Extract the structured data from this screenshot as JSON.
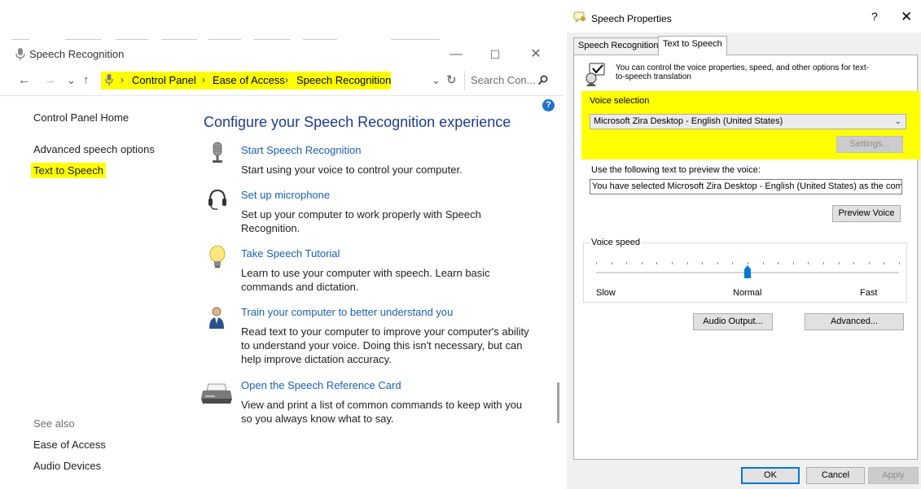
{
  "control_panel": {
    "window_title": "Speech Recognition",
    "window_controls": {
      "minimize": "—",
      "maximize": "☐",
      "close": "✕"
    },
    "nav": {
      "back": "←",
      "forward": "→",
      "recent": "⌄",
      "up": "↑",
      "refresh": "↻",
      "dropdown": "⌄"
    },
    "breadcrumb": [
      "Control Panel",
      "Ease of Access",
      "Speech Recognition"
    ],
    "breadcrumb_separator": "›",
    "search_placeholder": "Search Con...",
    "help_label": "?",
    "sidebar": {
      "home": "Control Panel Home",
      "links": [
        "Advanced speech options",
        "Text to Speech"
      ],
      "see_also_label": "See also",
      "see_also": [
        "Ease of Access",
        "Audio Devices"
      ]
    },
    "heading": "Configure your Speech Recognition experience",
    "tasks": [
      {
        "icon": "microphone-icon",
        "link": "Start Speech Recognition",
        "desc": "Start using your voice to control your computer."
      },
      {
        "icon": "headset-icon",
        "link": "Set up microphone",
        "desc": "Set up your computer to work properly with Speech Recognition."
      },
      {
        "icon": "lightbulb-icon",
        "link": "Take Speech Tutorial",
        "desc": "Learn to use your computer with speech.  Learn basic commands and dictation."
      },
      {
        "icon": "person-training-icon",
        "link": "Train your computer to better understand you",
        "desc": "Read text to your computer to improve your computer's ability to understand your voice.  Doing this isn't necessary, but can help improve dictation accuracy."
      },
      {
        "icon": "printer-icon",
        "link": "Open the Speech Reference Card",
        "desc": "View and print a list of common commands to keep with you so you always know what to say."
      }
    ],
    "highlight_color": "#ffff00",
    "link_color": "#1a5fb4"
  },
  "speech_properties": {
    "window_title": "Speech Properties",
    "help_button": "?",
    "close_button": "✕",
    "tabs": [
      {
        "label": "Speech Recognition",
        "active": false
      },
      {
        "label": "Text to Speech",
        "active": true
      }
    ],
    "intro": "You can control the voice properties, speed, and other options for text-to-speech translation",
    "voice_selection": {
      "label": "Voice selection",
      "selected": "Microsoft Zira Desktop - English (United States)",
      "settings_button": "Settings..."
    },
    "preview": {
      "label": "Use the following text to preview the voice:",
      "text": "You have selected Microsoft Zira Desktop - English (United States) as the computer's default voice.",
      "button": "Preview Voice"
    },
    "voice_speed": {
      "label": "Voice speed",
      "min_label": "Slow",
      "mid_label": "Normal",
      "max_label": "Fast",
      "value_fraction": 0.5,
      "ticks": 21
    },
    "buttons": {
      "audio_output": "Audio Output...",
      "advanced": "Advanced..."
    },
    "footer": {
      "ok": "OK",
      "cancel": "Cancel",
      "apply": "Apply"
    }
  }
}
